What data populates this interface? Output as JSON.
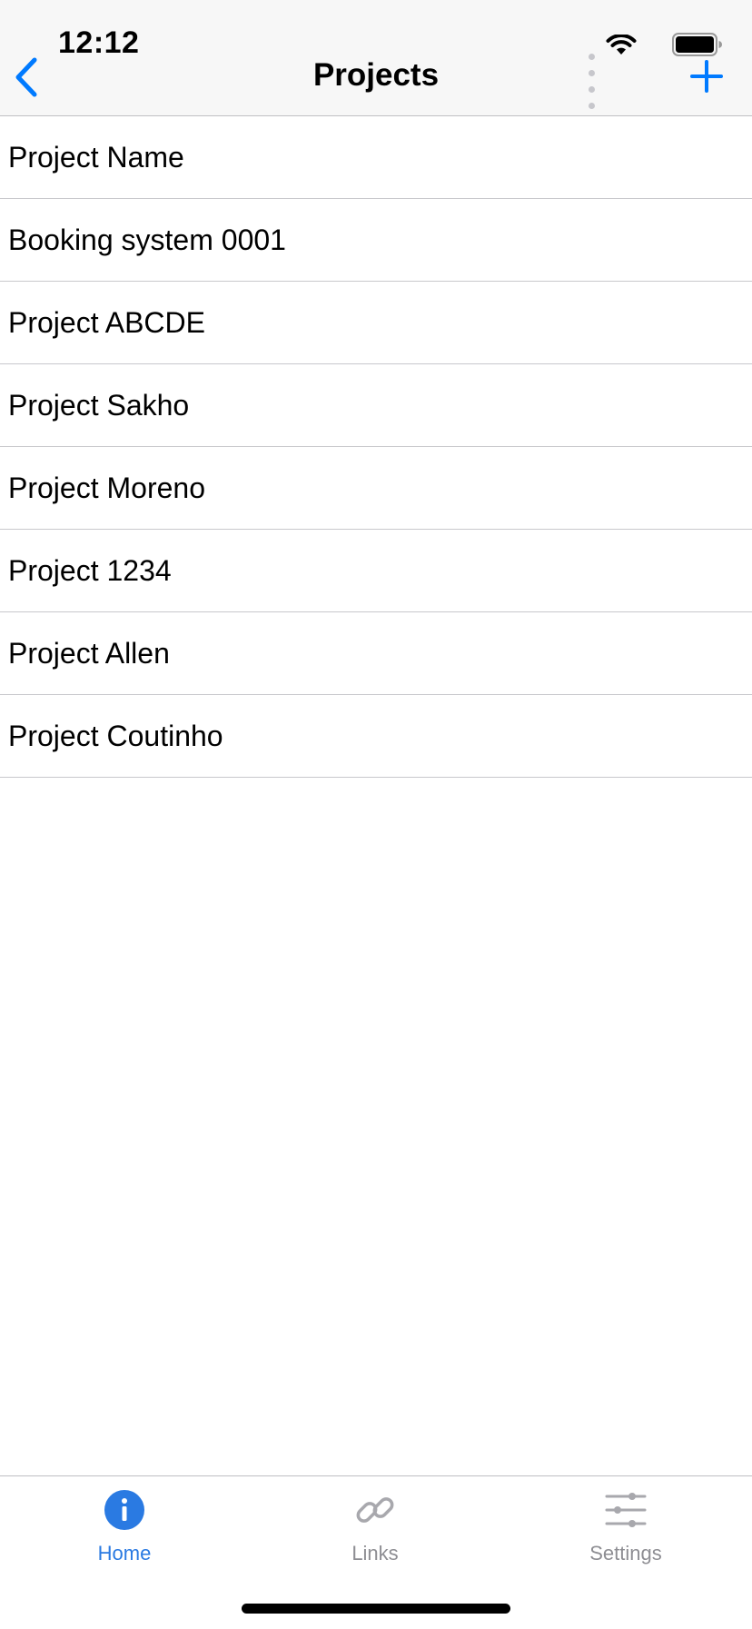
{
  "status_bar": {
    "time": "12:12"
  },
  "nav": {
    "title": "Projects"
  },
  "projects": [
    {
      "label": "Project Name"
    },
    {
      "label": "Booking system 0001"
    },
    {
      "label": "Project ABCDE"
    },
    {
      "label": "Project Sakho"
    },
    {
      "label": "Project Moreno"
    },
    {
      "label": "Project 1234"
    },
    {
      "label": "Project Allen"
    },
    {
      "label": "Project Coutinho"
    }
  ],
  "tabbar": {
    "tabs": [
      {
        "label": "Home",
        "icon": "info-icon",
        "active": true
      },
      {
        "label": "Links",
        "icon": "link-icon",
        "active": false
      },
      {
        "label": "Settings",
        "icon": "sliders-icon",
        "active": false
      }
    ]
  },
  "colors": {
    "accent": "#007aff",
    "tab_active": "#2a7ae2",
    "tab_inactive": "#8e8e93",
    "separator": "#c8c8cc",
    "nav_background": "#f7f7f7"
  }
}
